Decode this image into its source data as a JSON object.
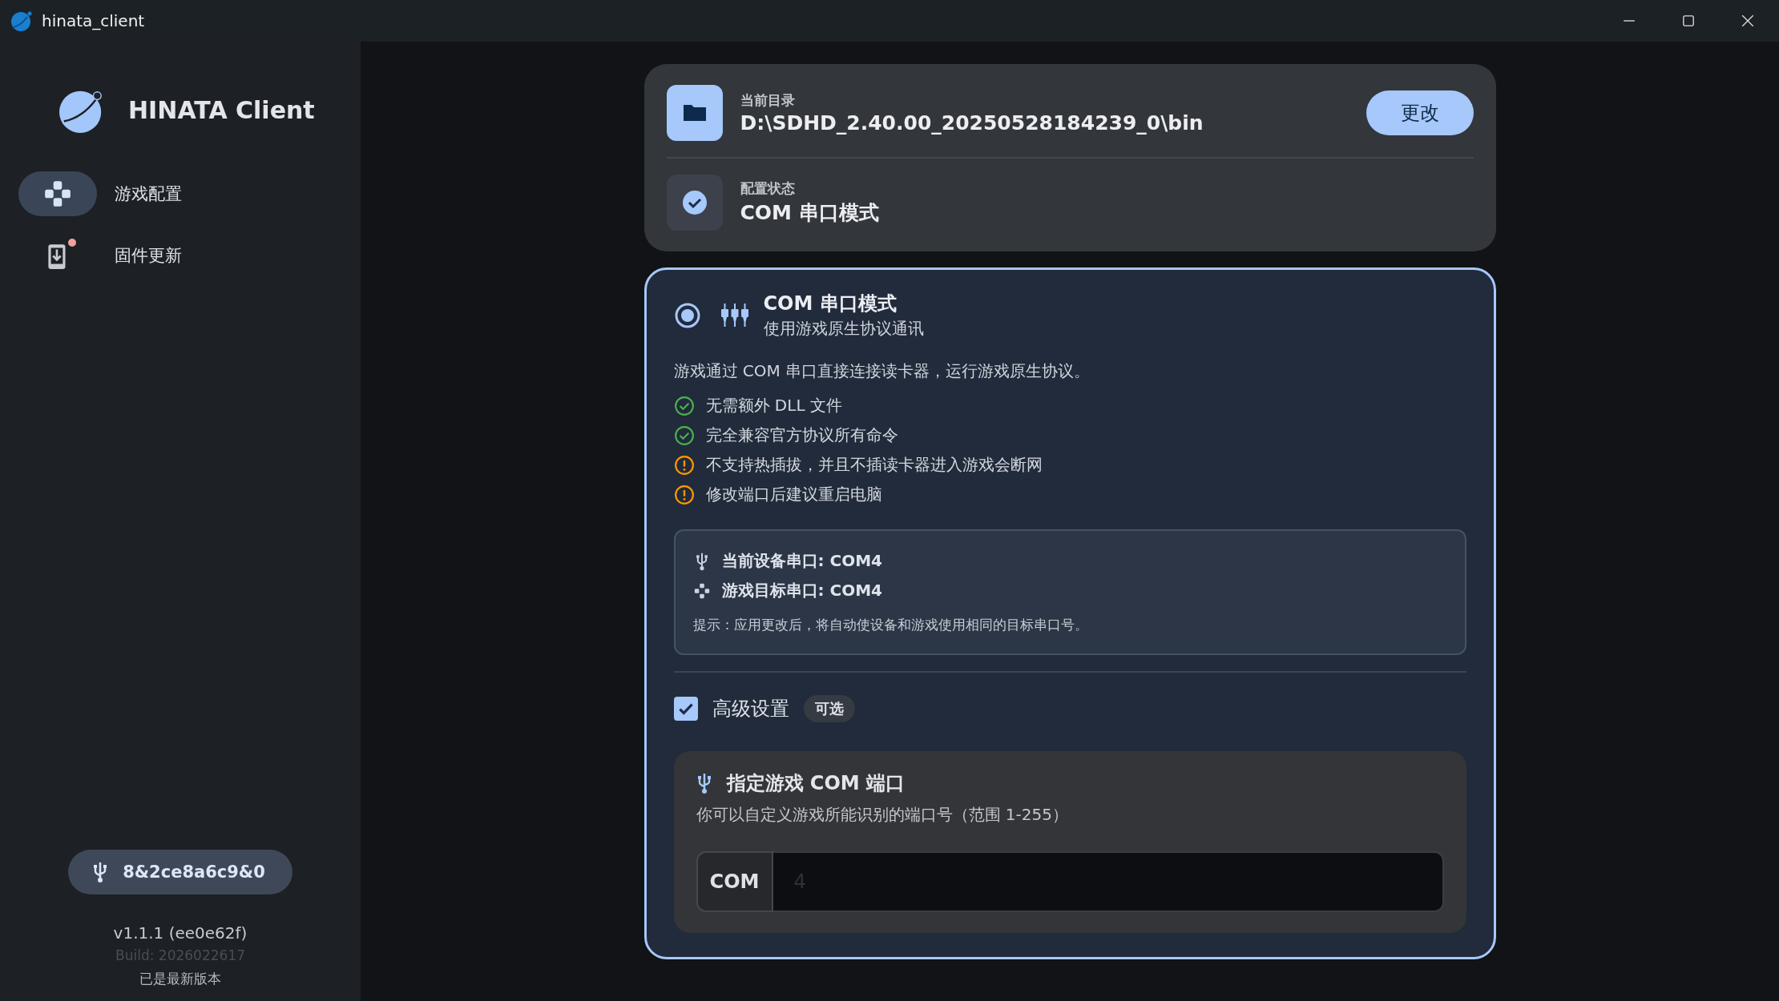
{
  "window": {
    "title": "hinata_client"
  },
  "sidebar": {
    "brand": "HINATA Client",
    "nav": [
      {
        "label": "游戏配置",
        "kind": "gamepad",
        "selected": true,
        "notification": false
      },
      {
        "label": "固件更新",
        "kind": "firmware",
        "selected": false,
        "notification": true
      }
    ],
    "device_chip": "8&2ce8a6c9&0",
    "version": "v1.1.1 (ee0e62f)",
    "build": "Build: 2026022617",
    "update_status": "已是最新版本"
  },
  "directory_card": {
    "directory": {
      "label": "当前目录",
      "value": "D:\\SDHD_2.40.00_20250528184239_0\\bin"
    },
    "change_button": "更改",
    "status": {
      "label": "配置状态",
      "value": "COM 串口模式"
    }
  },
  "mode_card": {
    "selected": true,
    "title": "COM 串口模式",
    "subtitle": "使用游戏原生协议通讯",
    "description": "游戏通过 COM 串口直接连接读卡器，运行游戏原生协议。",
    "features": [
      {
        "kind": "ok",
        "text": "无需额外 DLL 文件"
      },
      {
        "kind": "ok",
        "text": "完全兼容官方协议所有命令"
      },
      {
        "kind": "warn",
        "text": "不支持热插拔，并且不插读卡器进入游戏会断网"
      },
      {
        "kind": "warn",
        "text": "修改端口后建议重启电脑"
      }
    ],
    "port_info": {
      "lines": [
        {
          "kind": "device",
          "text": "当前设备串口: COM4"
        },
        {
          "kind": "game",
          "text": "游戏目标串口: COM4"
        }
      ],
      "hint": "提示：应用更改后，将自动使设备和游戏使用相同的目标串口号。"
    },
    "advanced": {
      "checked": true,
      "label": "高级设置",
      "tag": "可选"
    },
    "port_setting": {
      "title": "指定游戏 COM 端口",
      "description": "你可以自定义游戏所能识别的端口号（范围 1-255）",
      "prefix": "COM",
      "placeholder": "4"
    }
  }
}
